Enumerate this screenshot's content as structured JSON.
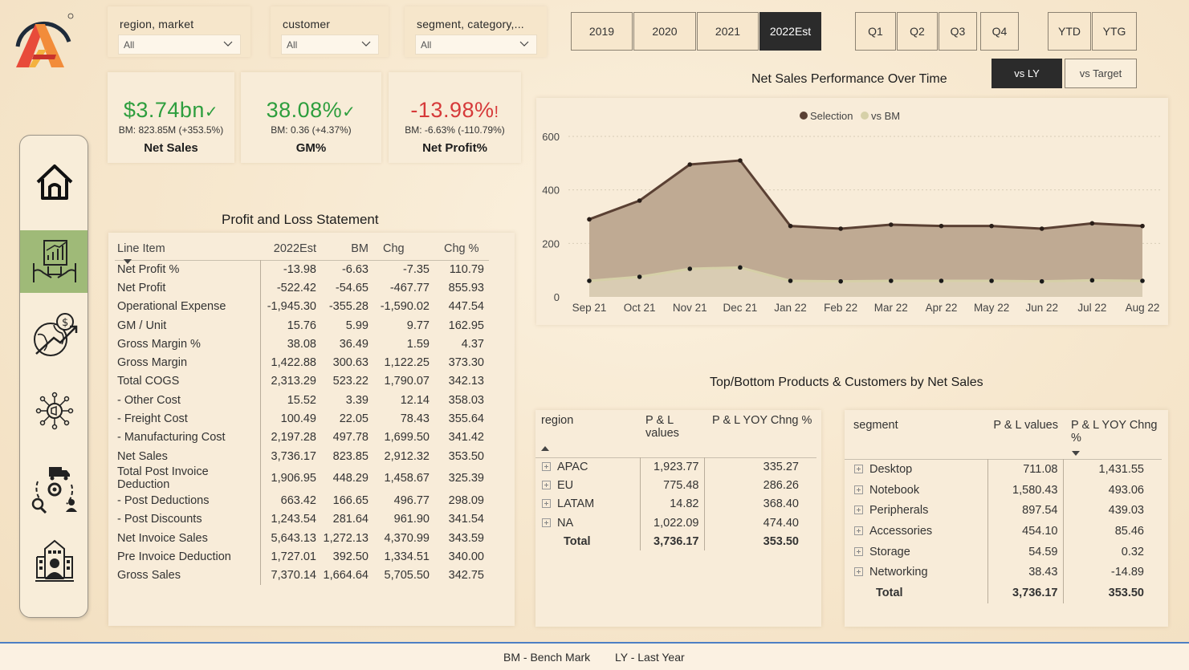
{
  "slicers": [
    {
      "title": "region, market",
      "value": "All"
    },
    {
      "title": "customer",
      "value": "All"
    },
    {
      "title": "segment, category,...",
      "value": "All"
    }
  ],
  "years": [
    "2019",
    "2020",
    "2021",
    "2022Est"
  ],
  "selected_year": "2022Est",
  "quarters": [
    "Q1",
    "Q2",
    "Q3",
    "Q4"
  ],
  "periods": [
    "YTD",
    "YTG"
  ],
  "compare": {
    "vs_ly": "vs LY",
    "vs_target": "vs Target",
    "selected": "vs LY"
  },
  "kpis": {
    "net_sales": {
      "value": "$3.74bn",
      "bm": "BM: 823.85M (+353.5%)",
      "label": "Net Sales",
      "status": "up"
    },
    "gm_pct": {
      "value": "38.08%",
      "bm": "BM: 0.36 (+4.37%)",
      "label": "GM%",
      "status": "up"
    },
    "net_profit_pct": {
      "value": "-13.98%",
      "bm": "BM: -6.63% (-110.79%)",
      "label": "Net Profit%",
      "status": "alert"
    }
  },
  "colors": {
    "positive": "#2e9e3e",
    "negative": "#d63a3a",
    "selection": "#5a4033",
    "bm": "#d6d0a8",
    "active_nav": "#9fba78"
  },
  "nav": [
    "home-icon",
    "finance-report-icon",
    "global-sales-icon",
    "marketing-icon",
    "supply-chain-icon",
    "executive-icon"
  ],
  "pl": {
    "title": "Profit and Loss Statement",
    "columns": [
      "Line Item",
      "2022Est",
      "BM",
      "Chg",
      "Chg %"
    ],
    "rows": [
      [
        "Net Profit %",
        "-13.98",
        "-6.63",
        "-7.35",
        "110.79"
      ],
      [
        "Net Profit",
        "-522.42",
        "-54.65",
        "-467.77",
        "855.93"
      ],
      [
        "Operational Expense",
        "-1,945.30",
        "-355.28",
        "-1,590.02",
        "447.54"
      ],
      [
        "GM / Unit",
        "15.76",
        "5.99",
        "9.77",
        "162.95"
      ],
      [
        "Gross Margin %",
        "38.08",
        "36.49",
        "1.59",
        "4.37"
      ],
      [
        "Gross Margin",
        "1,422.88",
        "300.63",
        "1,122.25",
        "373.30"
      ],
      [
        "Total COGS",
        "2,313.29",
        "523.22",
        "1,790.07",
        "342.13"
      ],
      [
        " - Other Cost",
        "15.52",
        "3.39",
        "12.14",
        "358.03"
      ],
      [
        " - Freight Cost",
        "100.49",
        "22.05",
        "78.43",
        "355.64"
      ],
      [
        " - Manufacturing Cost",
        "2,197.28",
        "497.78",
        "1,699.50",
        "341.42"
      ],
      [
        "Net Sales",
        "3,736.17",
        "823.85",
        "2,912.32",
        "353.50"
      ],
      [
        "Total Post Invoice Deduction",
        "1,906.95",
        "448.29",
        "1,458.67",
        "325.39"
      ],
      [
        " - Post Deductions",
        "663.42",
        "166.65",
        "496.77",
        "298.09"
      ],
      [
        " - Post Discounts",
        "1,243.54",
        "281.64",
        "961.90",
        "341.54"
      ],
      [
        "Net Invoice Sales",
        "5,643.13",
        "1,272.13",
        "4,370.99",
        "343.59"
      ],
      [
        "Pre Invoice Deduction",
        "1,727.01",
        "392.50",
        "1,334.51",
        "340.00"
      ],
      [
        "Gross Sales",
        "7,370.14",
        "1,664.64",
        "5,705.50",
        "342.75"
      ]
    ]
  },
  "chart_title": "Net Sales Performance Over Time",
  "chart_data": {
    "type": "area",
    "legend": [
      "Selection",
      "vs BM"
    ],
    "legend_position": "top-center",
    "categories": [
      "Sep 21",
      "Oct 21",
      "Nov 21",
      "Dec 21",
      "Jan 22",
      "Feb 22",
      "Mar 22",
      "Apr 22",
      "May 22",
      "Jun 22",
      "Jul 22",
      "Aug 22"
    ],
    "series": [
      {
        "name": "Selection",
        "values": [
          290,
          360,
          495,
          510,
          265,
          255,
          270,
          265,
          265,
          255,
          275,
          265
        ]
      },
      {
        "name": "vs BM",
        "values": [
          60,
          75,
          105,
          110,
          60,
          58,
          60,
          60,
          60,
          58,
          62,
          60
        ]
      }
    ],
    "yticks": [
      "600",
      "400",
      "200",
      "0"
    ],
    "ylim": [
      0,
      600
    ],
    "grid": true
  },
  "tb_title": "Top/Bottom Products & Customers by Net Sales",
  "region_matrix": {
    "columns": [
      "region",
      "P & L values",
      "P & L YOY Chng %"
    ],
    "rows": [
      [
        "APAC",
        "1,923.77",
        "335.27"
      ],
      [
        "EU",
        "775.48",
        "286.26"
      ],
      [
        "LATAM",
        "14.82",
        "368.40"
      ],
      [
        "NA",
        "1,022.09",
        "474.40"
      ]
    ],
    "total": [
      "Total",
      "3,736.17",
      "353.50"
    ]
  },
  "segment_matrix": {
    "columns": [
      "segment",
      "P & L values",
      "P & L YOY Chng %"
    ],
    "rows": [
      [
        "Desktop",
        "711.08",
        "1,431.55"
      ],
      [
        "Notebook",
        "1,580.43",
        "493.06"
      ],
      [
        "Peripherals",
        "897.54",
        "439.03"
      ],
      [
        "Accessories",
        "454.10",
        "85.46"
      ],
      [
        "Storage",
        "54.59",
        "0.32"
      ],
      [
        "Networking",
        "38.43",
        "-14.89"
      ]
    ],
    "total": [
      "Total",
      "3,736.17",
      "353.50"
    ]
  },
  "footer": {
    "bm": "BM - Bench Mark",
    "ly": "LY - Last Year"
  }
}
